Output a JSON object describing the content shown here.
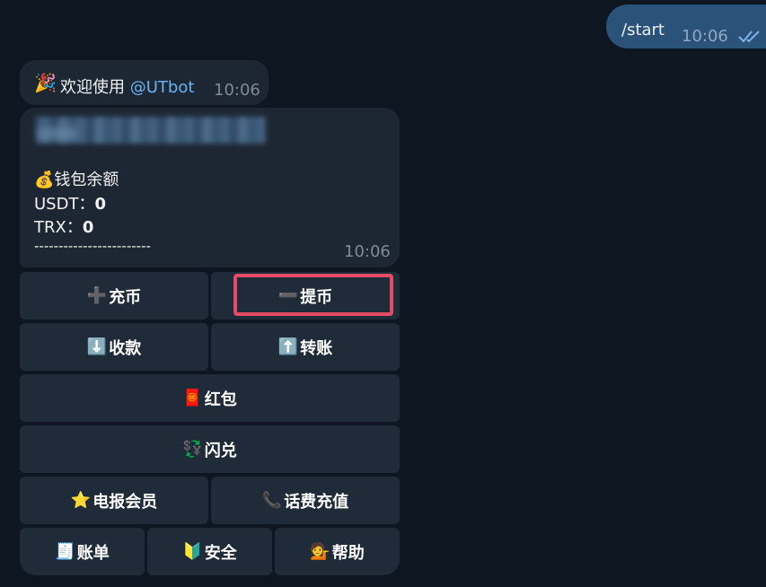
{
  "outgoing": {
    "text": "/start",
    "time": "10:06"
  },
  "welcome": {
    "prefix": "欢迎使用 ",
    "mention": "@UTbot",
    "time": "10:06",
    "icon": "party-popper-icon"
  },
  "wallet": {
    "title": "钱包余额",
    "usdt_label": "USDT：",
    "usdt_value": "0",
    "trx_label": "TRX：",
    "trx_value": "0",
    "divider": "------------------------",
    "time": "10:06"
  },
  "keyboard": {
    "deposit": "充币",
    "withdraw": "提币",
    "receive": "收款",
    "transfer": "转账",
    "red_packet": "红包",
    "flash_swap": "闪兑",
    "premium": "电报会员",
    "phone_topup": "话费充值",
    "bill": "账单",
    "security": "安全",
    "help": "帮助"
  },
  "colors": {
    "background": "#0e1621",
    "outgoing_bubble": "#2b5278",
    "incoming_bubble": "#1d2733",
    "button": "#1f2b38",
    "highlight": "#e64c66",
    "link": "#6ab3f3"
  }
}
